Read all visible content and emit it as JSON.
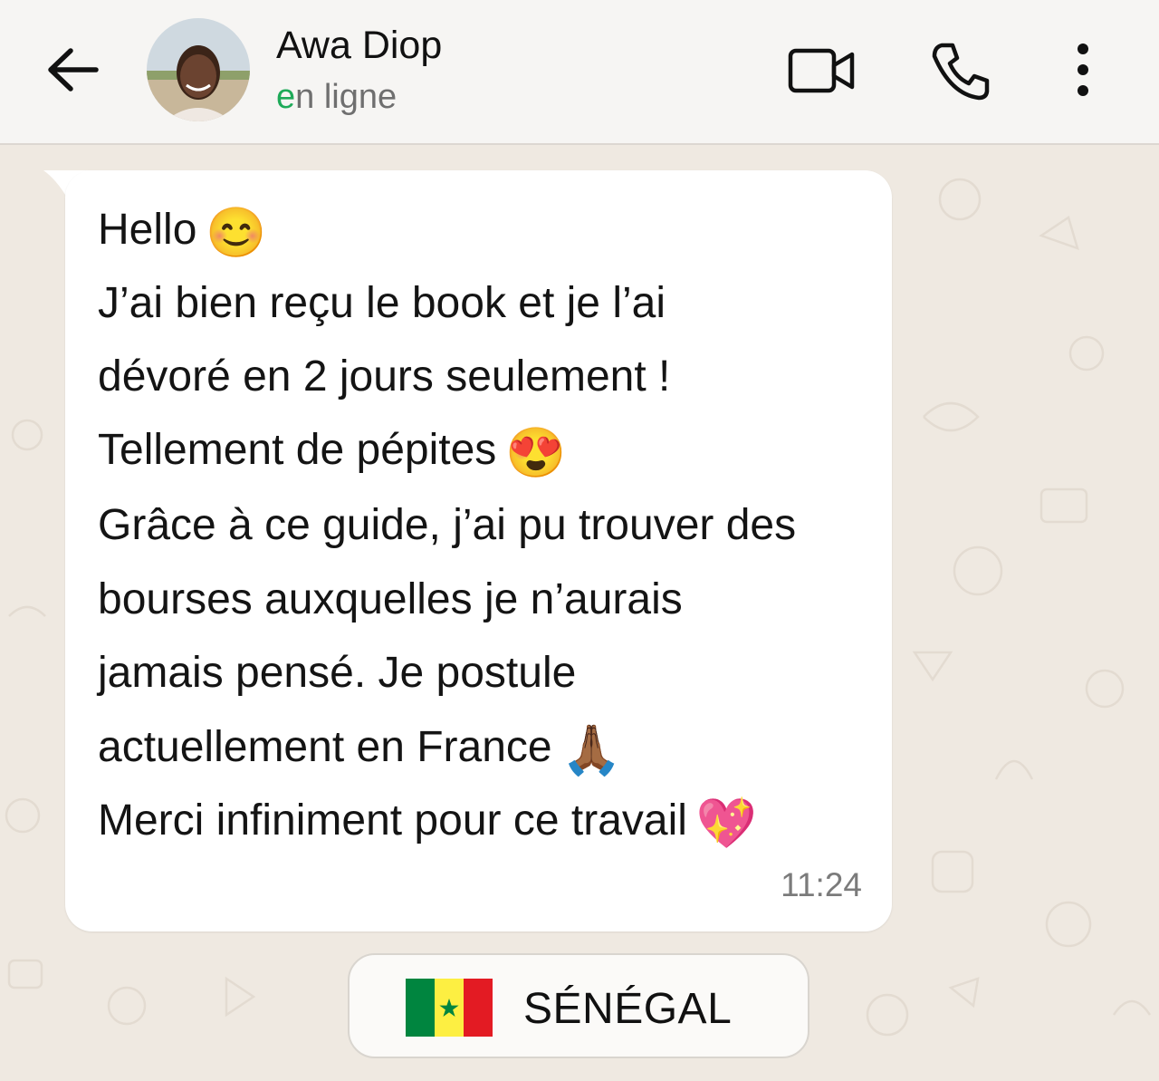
{
  "header": {
    "contact_name": "Awa Diop",
    "status_prefix": "e",
    "status_rest": "n ligne",
    "icons": [
      "back-arrow-icon",
      "video-camera-icon",
      "phone-icon",
      "more-vertical-icon"
    ]
  },
  "message": {
    "lines": [
      "Hello",
      "J’ai bien reçu le book et je l’ai",
      "dévoré en 2 jours seulement !",
      "Tellement de pépites",
      "Grâce à ce guide, j’ai pu trouver des",
      "bourses auxquelles je n’aurais",
      "jamais pensé. Je postule",
      "actuellement en France",
      "Merci infiniment pour ce travail"
    ],
    "emojis": {
      "line_0": "😊",
      "line_3": "😍",
      "line_7": "🙏🏾",
      "line_8": "💖"
    },
    "time": "11:24"
  },
  "country": {
    "label": "SÉNÉGAL",
    "flag_colors": [
      "#00853f",
      "#fdef42",
      "#e31b23"
    ]
  },
  "colors": {
    "online_green": "#1faa59",
    "chat_background": "#efe9e1",
    "bubble": "#ffffff"
  }
}
